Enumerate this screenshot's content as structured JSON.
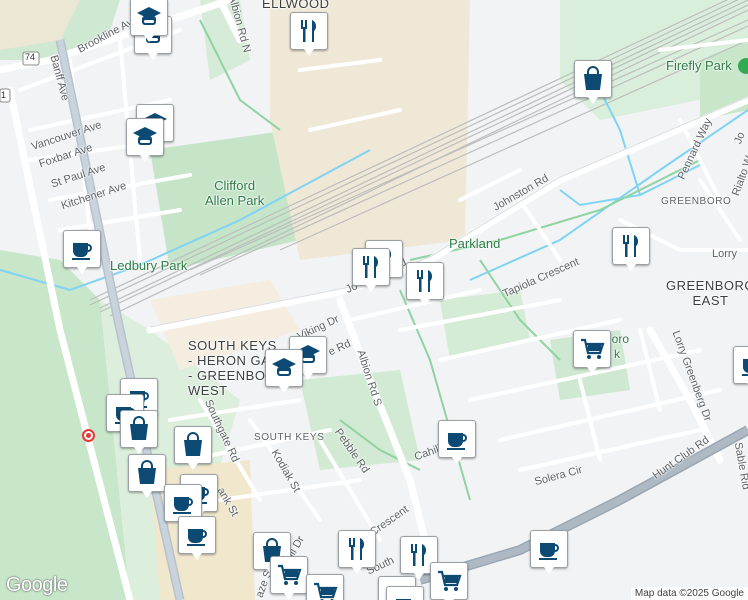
{
  "map": {
    "provider_logo": "Google",
    "attribution": "Map data ©2025 Google",
    "route_shield": "74",
    "route_shield_2": "1"
  },
  "places": {
    "firefly_park": "Firefly Park",
    "clifford_allen_park": "Clifford\nAllen Park",
    "ledbury_park": "Ledbury Park",
    "parkland": "Parkland",
    "greenboro": "GREENBORO",
    "greenboro_east": "GREENBORO\nEAST",
    "south_keys": "SOUTH KEYS\n- HERON GA\n- GREENBO\nWEST",
    "south_keys_2": "SOUTH KEYS",
    "ellwood": "ELLWOOD",
    "greenboro_park": "boro\nk"
  },
  "streets": {
    "brookline": "Brookline Av",
    "albion_rd_n": "Albion Rd N",
    "banff": "Banff Ave",
    "vancouver": "Vancouver Ave",
    "foxbar": "Foxbar Ave",
    "st_paul": "St Paul Ave",
    "kitchener": "Kitchener Ave",
    "johnston_rd": "Johnston Rd",
    "johnston_rd_2": "Jo",
    "johnston_rd_3": "d",
    "tapiola": "Tapiola Crescent",
    "pennard": "Pennard Way",
    "rialto": "Rialto W",
    "jo": "Jo",
    "lorry": "Lorry",
    "lorry_greenberg": "Lorry Greenberg Dr",
    "viking": "Viking Dr",
    "rd": "e Rd",
    "albion_rd_s": "Albion Rd S",
    "southgate": "Southgate Rd",
    "kodiak": "Kodiak St",
    "pebble": "Pebble Rd",
    "cahill": "Cahill",
    "cahill_dr": "ahill Dr",
    "bank_st": "ank St",
    "way_crescent": "Way Crescent",
    "hunt_club": "Hunt Club Rd",
    "solera": "Solera Cir",
    "sable": "Sable Rid",
    "southe": "South",
    "aze": "aze S"
  },
  "pins": {
    "school": "school-icon",
    "restaurant": "restaurant-icon",
    "shopping": "shopping-bag-icon",
    "cafe": "cafe-icon",
    "grocery": "grocery-cart-icon",
    "color_icon": "#0d4a73"
  }
}
